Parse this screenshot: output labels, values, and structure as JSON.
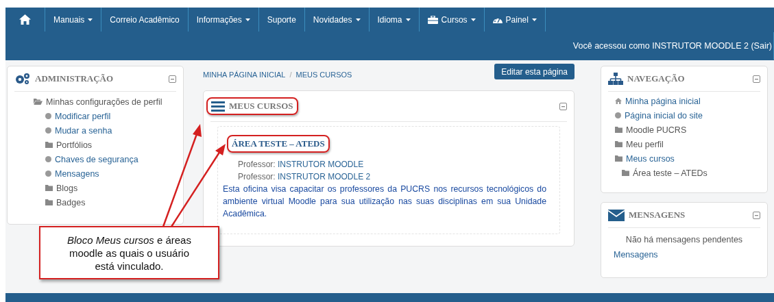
{
  "nav": {
    "items": [
      {
        "label": "Manuais",
        "dropdown": true
      },
      {
        "label": "Correio Acadêmico",
        "dropdown": false
      },
      {
        "label": "Informações",
        "dropdown": true
      },
      {
        "label": "Suporte",
        "dropdown": false
      },
      {
        "label": "Novidades",
        "dropdown": true
      },
      {
        "label": "Idioma",
        "dropdown": true
      },
      {
        "label": "Cursos",
        "dropdown": true
      },
      {
        "label": "Painel",
        "dropdown": true
      }
    ],
    "login_info": "Você acessou como INSTRUTOR MOODLE 2 (Sair)"
  },
  "admin_block": {
    "title": "ADMINISTRAÇÃO",
    "items": [
      {
        "label": "Minhas configurações de perfil",
        "kind": "folder-open",
        "children": [
          {
            "label": "Modificar perfil",
            "kind": "bullet"
          },
          {
            "label": "Mudar a senha",
            "kind": "bullet"
          },
          {
            "label": "Portfólios",
            "kind": "folder"
          },
          {
            "label": "Chaves de segurança",
            "kind": "bullet"
          },
          {
            "label": "Mensagens",
            "kind": "bullet"
          },
          {
            "label": "Blogs",
            "kind": "folder"
          },
          {
            "label": "Badges",
            "kind": "folder"
          }
        ]
      }
    ]
  },
  "breadcrumb": [
    "MINHA PÁGINA INICIAL",
    "MEUS CURSOS"
  ],
  "breadcrumb_separator": "/",
  "edit_button": "Editar esta página",
  "courses_block": {
    "title": "MEUS CURSOS",
    "highlighted": true,
    "courses": [
      {
        "title": "ÁREA TESTE – ATEDS",
        "highlighted": true,
        "teachers": [
          {
            "role": "Professor:",
            "name": "INSTRUTOR MOODLE"
          },
          {
            "role": "Professor:",
            "name": "INSTRUTOR MOODLE 2"
          }
        ],
        "summary": "Esta oficina visa capacitar os professores da PUCRS nos recursos tecnológicos do ambiente virtual Moodle para sua utilização nas suas disciplinas em sua Unidade Acadêmica."
      }
    ]
  },
  "navigation_block": {
    "title": "NAVEGAÇÃO",
    "items": [
      {
        "label": "Minha página inicial",
        "kind": "home",
        "link": true
      },
      {
        "label": "Página inicial do site",
        "kind": "bullet",
        "link": true
      },
      {
        "label": "Moodle PUCRS",
        "kind": "folder",
        "link": false
      },
      {
        "label": "Meu perfil",
        "kind": "folder",
        "link": false
      },
      {
        "label": "Meus cursos",
        "kind": "folder",
        "link": true,
        "children": [
          {
            "label": "Área teste – ATEDs",
            "kind": "folder",
            "link": false
          }
        ]
      }
    ]
  },
  "messages_block": {
    "title": "MENSAGENS",
    "empty_text": "Não há mensagens pendentes",
    "link": "Mensagens"
  },
  "callout": "*Bloco Meus cursos* e áreas moodle as quais o usuário está vinculado."
}
